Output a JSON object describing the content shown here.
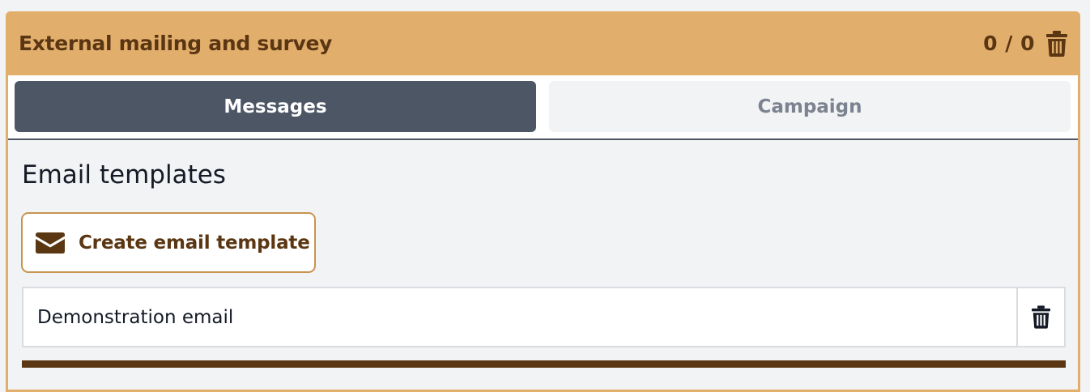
{
  "panel": {
    "title": "External mailing and survey",
    "counter": "0 / 0",
    "delete_icon": "trash-icon"
  },
  "tabs": [
    {
      "label": "Messages",
      "active": true
    },
    {
      "label": "Campaign",
      "active": false
    }
  ],
  "section": {
    "title": "Email templates"
  },
  "create_button": {
    "label": "Create email template",
    "icon": "envelope-icon"
  },
  "templates": [
    {
      "name": "Demonstration email",
      "delete_icon": "trash-icon"
    }
  ],
  "colors": {
    "header_bg": "#e2ae6b",
    "header_text": "#5b3613",
    "tab_active_bg": "#4d5665",
    "tab_inactive_text": "#7b8390",
    "accent_border": "#c8944e"
  }
}
